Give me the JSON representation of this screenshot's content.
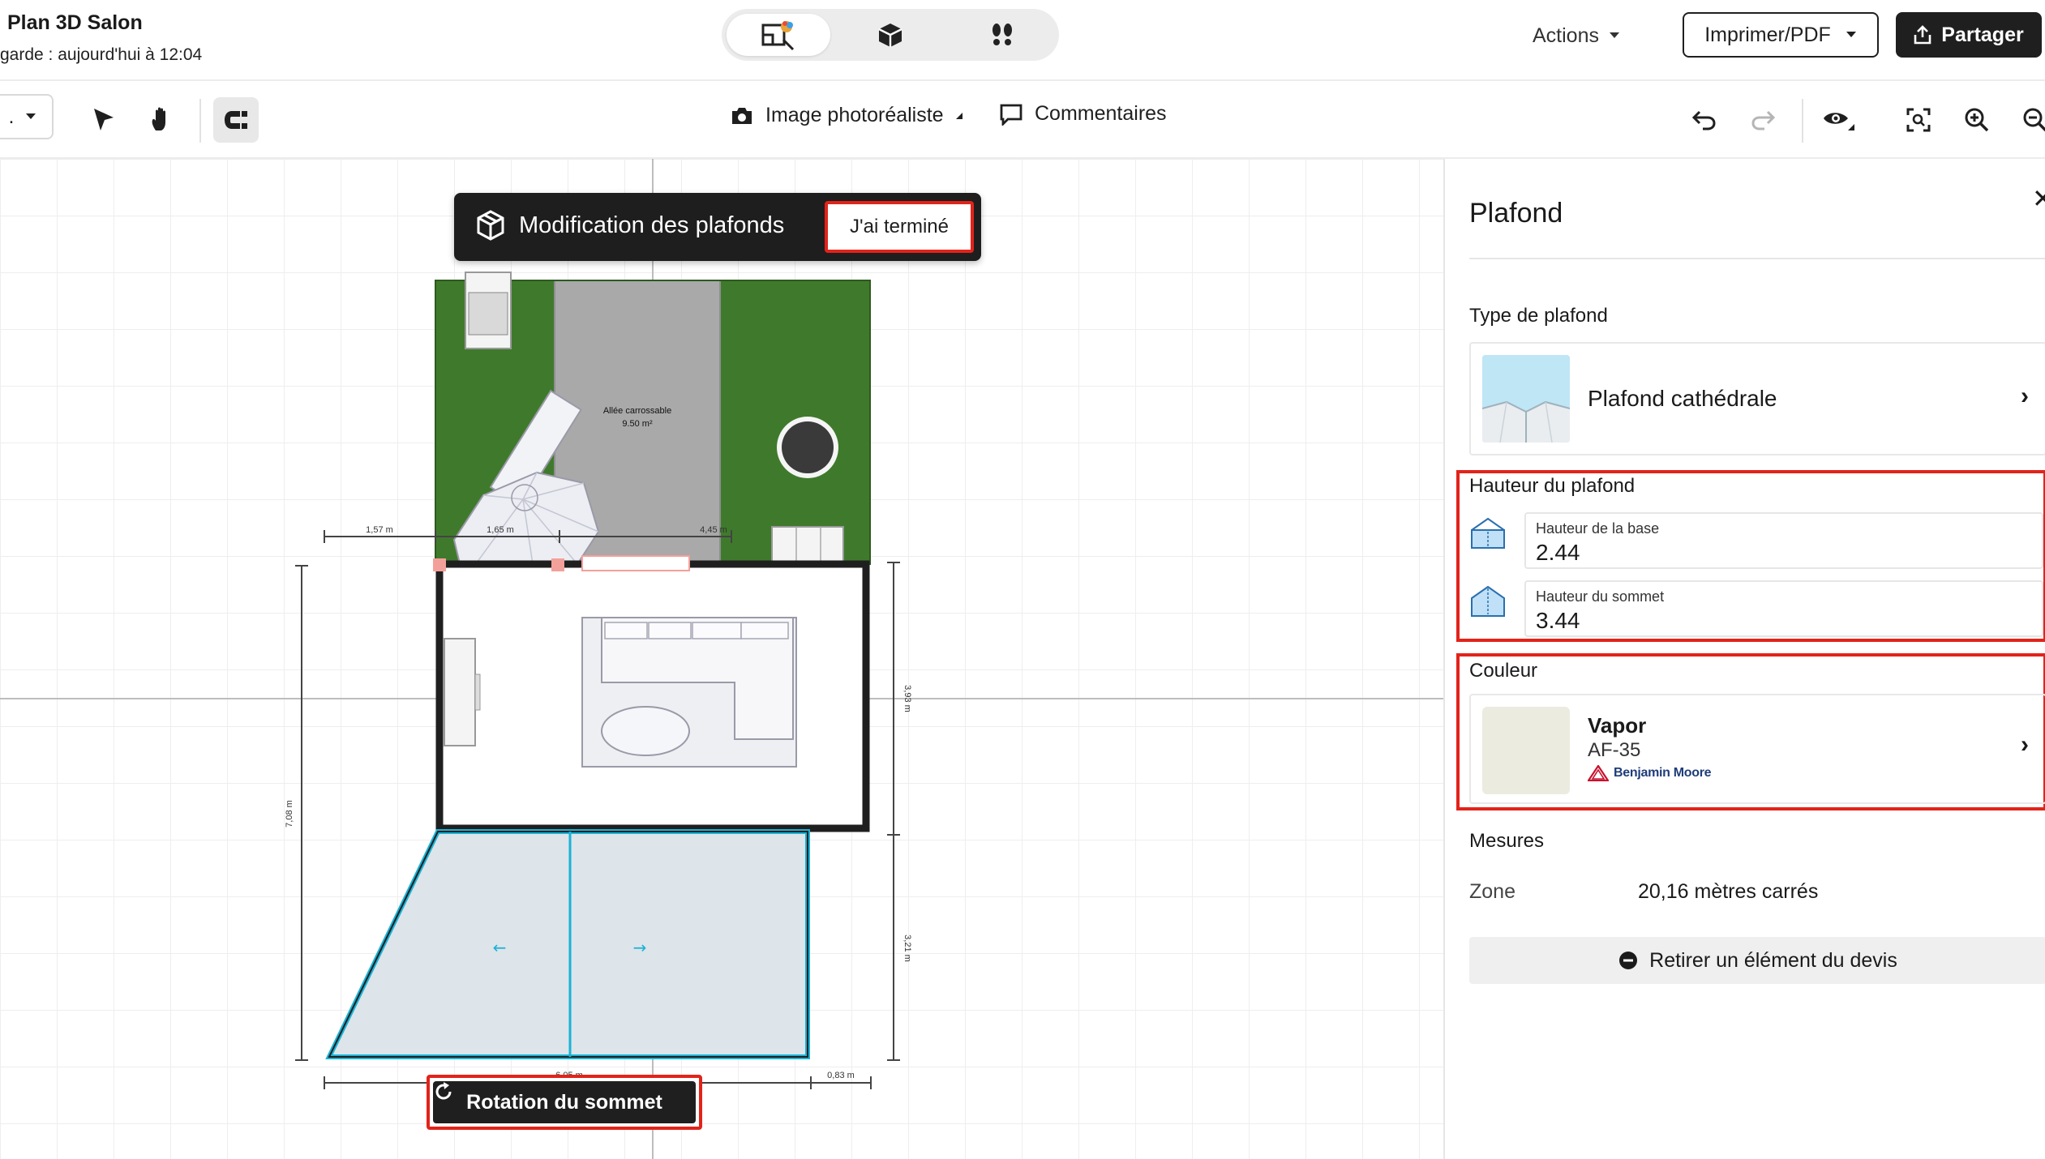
{
  "header": {
    "project_title": "Plan 3D Salon",
    "save_status": "garde : aujourd'hui à 12:04",
    "actions_label": "Actions",
    "print_label": "Imprimer/PDF",
    "share_label": "Partager"
  },
  "toolbar": {
    "level_value": ".",
    "photo_label": "Image photoréaliste",
    "comments_label": "Commentaires"
  },
  "canvas": {
    "mode_title": "Modification des plafonds",
    "done_label": "J'ai terminé",
    "rotate_label": "Rotation du sommet",
    "driveway_label": "Allée carrossable",
    "driveway_area": "9.50 m²",
    "dims": {
      "d1": "1,57 m",
      "d2": "1,65 m",
      "d3": "4,45 m",
      "d4": "3,93 m",
      "d5": "7,08 m",
      "d6": "3,21 m",
      "d7": "6,05 m",
      "d8": "0,83 m"
    }
  },
  "panel": {
    "title": "Plafond",
    "type_section": "Type de plafond",
    "type_name": "Plafond cathédrale",
    "height_section": "Hauteur du plafond",
    "base_label": "Hauteur de la base",
    "base_value": "2.44",
    "top_label": "Hauteur du sommet",
    "top_value": "3.44",
    "color_section": "Couleur",
    "color_name": "Vapor",
    "color_code": "AF-35",
    "color_brand": "Benjamin Moore",
    "measures_section": "Mesures",
    "zone_label": "Zone",
    "zone_value": "20,16 mètres carrés",
    "remove_label": "Retirer un élément du devis"
  },
  "colors": {
    "accent_red": "#e2231a",
    "swatch_vapor": "#ecebe0",
    "grass": "#3f7a2c",
    "ceiling_selection": "#19b3d6"
  }
}
